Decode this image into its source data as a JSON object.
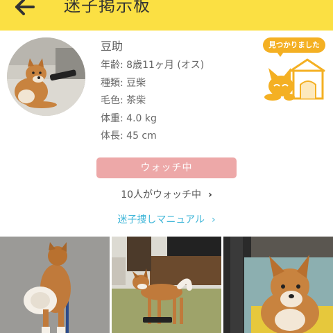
{
  "header": {
    "title": "迷子掲示板",
    "back_icon": "arrow-left-icon"
  },
  "dog": {
    "name": "豆助",
    "attributes": [
      {
        "label": "年齢:",
        "value": "8歳11ヶ月 (オス)"
      },
      {
        "label": "種類:",
        "value": "豆柴"
      },
      {
        "label": "毛色:",
        "value": "茶柴"
      },
      {
        "label": "体重:",
        "value": "4.0 kg"
      },
      {
        "label": "体長:",
        "value": "45 cm"
      }
    ]
  },
  "status_badge": {
    "label": "見つかりました",
    "color": "#f4b023"
  },
  "watch": {
    "button_label": "ウォッチ中",
    "button_color": "#eda8a8",
    "count_text": "10人がウォッチ中",
    "count_chevron": "›"
  },
  "manual": {
    "link_text": "迷子捜しマニュアル",
    "chevron": "›",
    "color": "#3fb6d8"
  },
  "colors": {
    "header_bg": "#fbe043"
  }
}
